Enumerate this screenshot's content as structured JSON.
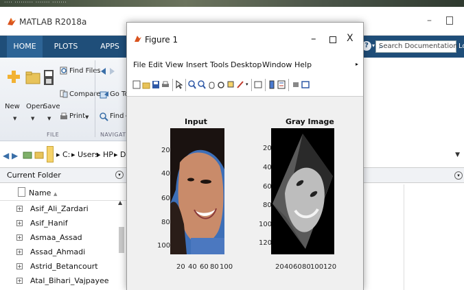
{
  "matlab": {
    "title": "MATLAB R2018a",
    "tabs": [
      "HOME",
      "PLOTS",
      "APPS"
    ],
    "search_placeholder": "Search Documentation",
    "login_partial": "Lo"
  },
  "toolstrip": {
    "file": {
      "new": "New",
      "open": "Open",
      "save": "Save",
      "find_files": "Find Files",
      "compare": "Compare",
      "print": "Print",
      "group": "FILE"
    },
    "navigate": {
      "go_to": "Go To",
      "find": "Find",
      "group": "NAVIGATE"
    }
  },
  "address": {
    "path": [
      "C:",
      "Users",
      "HP",
      "Desktop"
    ]
  },
  "current_folder": {
    "title": "Current Folder",
    "column": "Name",
    "sort_indicator": "▲",
    "items": [
      "Asif_Ali_Zardari",
      "Asif_Hanif",
      "Asmaa_Assad",
      "Assad_Ahmadi",
      "Astrid_Betancourt",
      "Atal_Bihari_Vajpayee"
    ]
  },
  "figure": {
    "title": "Figure 1",
    "menu": [
      "File",
      "Edit",
      "View",
      "Insert",
      "Tools",
      "Desktop",
      "Window",
      "Help"
    ],
    "axes": [
      {
        "title": "Input",
        "yticks": [
          "20",
          "40",
          "60",
          "80",
          "100"
        ],
        "xticks": [
          "20",
          "40",
          "60",
          "80",
          "100"
        ]
      },
      {
        "title": "Gray Image",
        "yticks": [
          "20",
          "40",
          "60",
          "80",
          "100",
          "120"
        ],
        "xticks": [
          "20",
          "40",
          "60",
          "80",
          "100",
          "120"
        ]
      }
    ]
  },
  "colors": {
    "tab_bar": "#1f4e79",
    "tab_active": "#2d6496",
    "input_bg": "#3d6fb8"
  }
}
